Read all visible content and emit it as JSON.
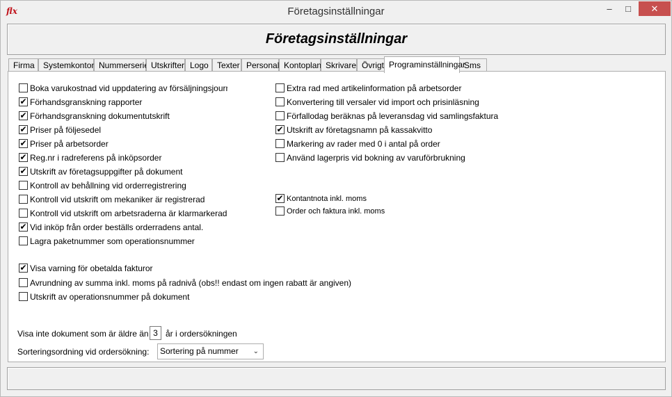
{
  "window": {
    "title": "Företagsinställningar",
    "app_icon": "flx",
    "controls": {
      "minimize": "–",
      "maximize": "□",
      "close": "✕"
    }
  },
  "header": {
    "title": "Företagsinställningar"
  },
  "tabs": [
    {
      "label": "Firma"
    },
    {
      "label": "Systemkonton"
    },
    {
      "label": "Nummerserier"
    },
    {
      "label": "Utskrifter"
    },
    {
      "label": "Logo"
    },
    {
      "label": "Texter"
    },
    {
      "label": "Personal"
    },
    {
      "label": "Kontoplan"
    },
    {
      "label": "Skrivare"
    },
    {
      "label": "Övrigt"
    },
    {
      "label": "Programinställningar",
      "active": true
    },
    {
      "label": "Sms"
    }
  ],
  "left_options": [
    {
      "label": "Boka varukostnad vid uppdatering av försäljningsjourn",
      "checked": false
    },
    {
      "label": "Förhandsgranskning rapporter",
      "checked": true
    },
    {
      "label": "Förhandsgranskning dokumentutskrift",
      "checked": true
    },
    {
      "label": "Priser på följesedel",
      "checked": true
    },
    {
      "label": "Priser på arbetsorder",
      "checked": true
    },
    {
      "label": "Reg.nr i radreferens på inköpsorder",
      "checked": true
    },
    {
      "label": "Utskrift av företagsuppgifter på dokument",
      "checked": true
    },
    {
      "label": "Kontroll av behållning vid orderregistrering",
      "checked": false
    },
    {
      "label": "Kontroll  vid utskrift om mekaniker är registrerad",
      "checked": false
    },
    {
      "label": "Kontroll vid utskrift om arbetsraderna är klarmarkerade",
      "checked": false
    },
    {
      "label": "Vid inköp från order beställs orderradens antal.",
      "checked": true
    },
    {
      "label": "Lagra paketnummer som operationsnummer",
      "checked": false
    }
  ],
  "right_options": [
    {
      "label": "Extra rad med artikelinformation på arbetsorder",
      "checked": false
    },
    {
      "label": "Konvertering till versaler vid import och prisinläsning",
      "checked": false
    },
    {
      "label": "Förfallodag beräknas på leveransdag vid samlingsfaktura",
      "checked": false
    },
    {
      "label": "Utskrift av företagsnamn på kassakvitto",
      "checked": true
    },
    {
      "label": "Markering av rader med 0 i antal på order",
      "checked": false
    },
    {
      "label": "Använd lagerpris vid bokning av varuförbrukning",
      "checked": false
    }
  ],
  "vat_options": [
    {
      "label": "Kontantnota inkl. moms",
      "checked": true
    },
    {
      "label": "Order och faktura inkl. moms",
      "checked": false
    }
  ],
  "bottom_options": [
    {
      "label": "Visa varning för obetalda fakturor",
      "checked": true
    },
    {
      "label": "Avrundning av summa inkl. moms på radnivå (obs!! endast om ingen rabatt är angiven)",
      "checked": false
    },
    {
      "label": "Utskrift av operationsnummer på dokument",
      "checked": false
    }
  ],
  "years_filter": {
    "prefix": "Visa inte dokument som är äldre än",
    "value": "3",
    "suffix": "år i ordersökningen"
  },
  "sort_order": {
    "label": "Sorteringsordning vid ordersökning:",
    "selected": "Sortering på nummer"
  },
  "check_mark": "✔"
}
